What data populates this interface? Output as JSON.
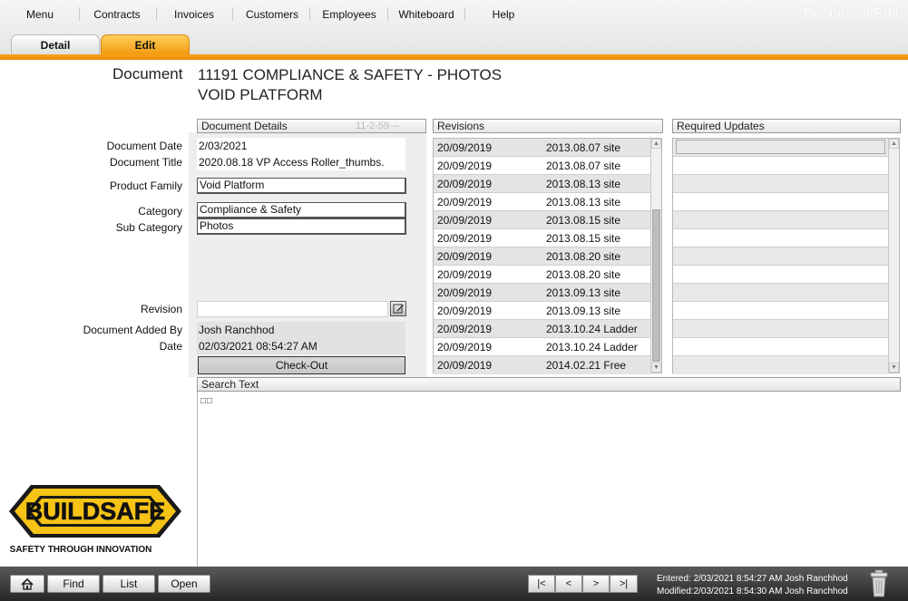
{
  "menu": {
    "items": [
      "Menu",
      "Contracts",
      "Invoices",
      "Customers",
      "Employees",
      "Whiteboard",
      "Help"
    ]
  },
  "app_title": "Document Edit",
  "tabs": {
    "detail": "Detail",
    "edit": "Edit"
  },
  "document": {
    "label": "Document",
    "title_line1": "11191 COMPLIANCE & SAFETY - PHOTOS",
    "title_line2": "VOID PLATFORM"
  },
  "labels": {
    "document_date": "Document Date",
    "document_title": "Document Title",
    "product_family": "Product Family",
    "category": "Category",
    "sub_category": "Sub Category",
    "revision": "Revision",
    "document_added_by": "Document Added By",
    "date": "Date"
  },
  "details": {
    "header": "Document Details",
    "faint_id": "11-2-59---",
    "document_date": "2/03/2021",
    "document_title": "2020.08.18 VP Access Roller_thumbs.",
    "product_family": "Void Platform",
    "category": "Compliance & Safety",
    "sub_category": "Photos",
    "revision": "",
    "added_by": "Josh Ranchhod",
    "added_date": "02/03/2021 08:54:27 AM",
    "checkout_label": "Check-Out"
  },
  "revisions": {
    "header": "Revisions",
    "rows": [
      {
        "date": "20/09/2019",
        "name": "2013.08.07 site"
      },
      {
        "date": "20/09/2019",
        "name": "2013.08.07 site"
      },
      {
        "date": "20/09/2019",
        "name": "2013.08.13 site"
      },
      {
        "date": "20/09/2019",
        "name": "2013.08.13 site"
      },
      {
        "date": "20/09/2019",
        "name": "2013.08.15 site"
      },
      {
        "date": "20/09/2019",
        "name": "2013.08.15 site"
      },
      {
        "date": "20/09/2019",
        "name": "2013.08.20 site"
      },
      {
        "date": "20/09/2019",
        "name": "2013.08.20 site"
      },
      {
        "date": "20/09/2019",
        "name": "2013.09.13 site"
      },
      {
        "date": "20/09/2019",
        "name": "2013.09.13 site"
      },
      {
        "date": "20/09/2019",
        "name": "2013.10.24 Ladder"
      },
      {
        "date": "20/09/2019",
        "name": "2013.10.24 Ladder"
      },
      {
        "date": "20/09/2019",
        "name": "2014.02.21 Free"
      }
    ]
  },
  "required_updates": {
    "header": "Required Updates"
  },
  "search": {
    "header": "Search Text",
    "content": "□□"
  },
  "logo": {
    "brand": "BUILDSAFE",
    "tagline": "SAFETY THROUGH INNOVATION"
  },
  "bottom": {
    "find": "Find",
    "list": "List",
    "open": "Open",
    "first": "|<",
    "prev": "<",
    "next": ">",
    "last": ">|",
    "entered": "Entered:  2/03/2021 8:54:27 AM Josh Ranchhod",
    "modified": "Modified:2/03/2021 8:54:30 AM Josh Ranchhod"
  },
  "icons": {
    "home": "home-icon",
    "trash": "trash-icon",
    "edit": "edit-pencil-icon"
  },
  "colors": {
    "accent_orange": "#f39a10",
    "bottom_bar": "#2f2f2f"
  }
}
